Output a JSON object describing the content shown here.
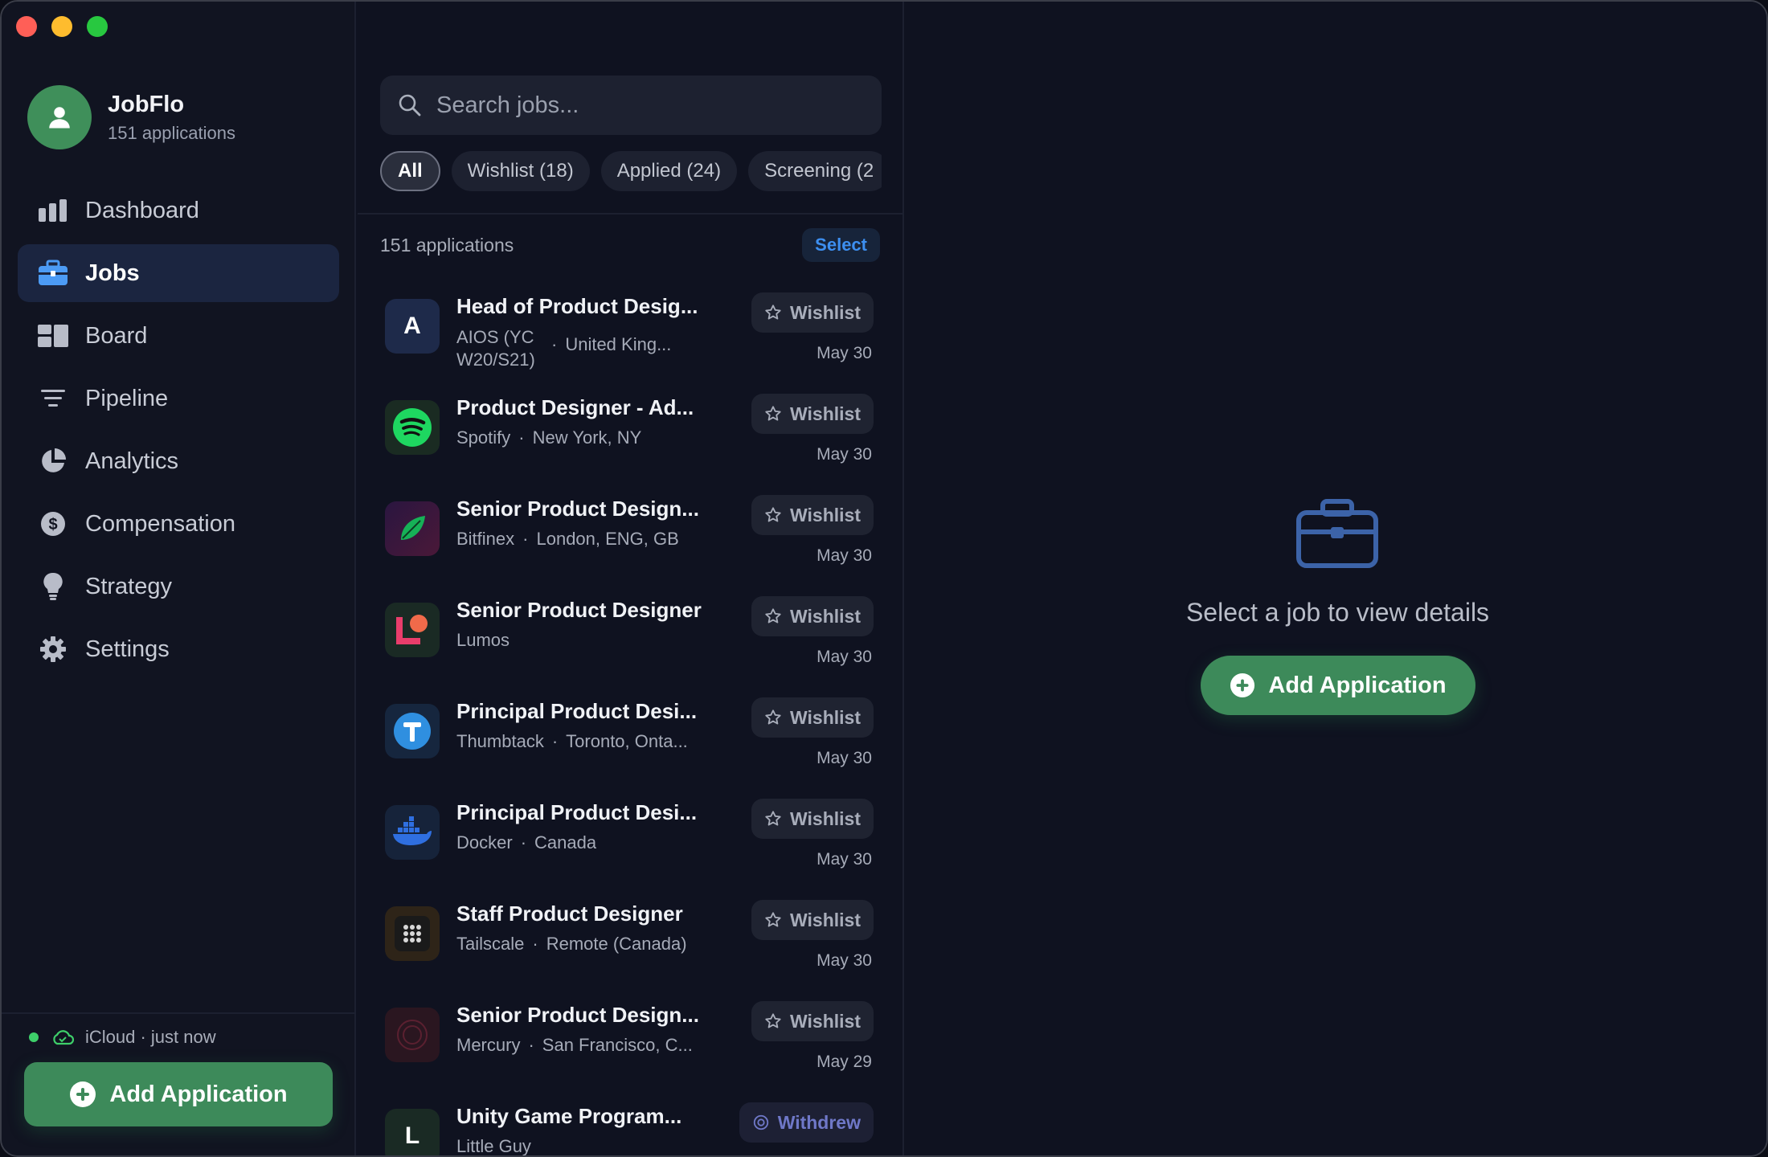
{
  "app": {
    "name": "JobFlo",
    "subtitle": "151 applications"
  },
  "sidebar": {
    "items": [
      {
        "label": "Dashboard",
        "icon": "dashboard-icon"
      },
      {
        "label": "Jobs",
        "icon": "briefcase-icon",
        "active": true
      },
      {
        "label": "Board",
        "icon": "board-icon"
      },
      {
        "label": "Pipeline",
        "icon": "pipeline-icon"
      },
      {
        "label": "Analytics",
        "icon": "pie-chart-icon"
      },
      {
        "label": "Compensation",
        "icon": "dollar-icon"
      },
      {
        "label": "Strategy",
        "icon": "lightbulb-icon"
      },
      {
        "label": "Settings",
        "icon": "gear-icon"
      }
    ],
    "sync_status": "iCloud · just now",
    "add_button": "Add Application"
  },
  "list": {
    "search_placeholder": "Search jobs...",
    "filters": [
      "All",
      "Wishlist (18)",
      "Applied (24)",
      "Screening (2"
    ],
    "count": "151 applications",
    "select_label": "Select",
    "jobs": [
      {
        "title": "Head of Product Desig...",
        "company": "AIOS (YC W20/S21)",
        "location": "United King...",
        "status": "Wishlist",
        "date": "May 30"
      },
      {
        "title": "Product Designer - Ad...",
        "company": "Spotify",
        "location": "New York, NY",
        "status": "Wishlist",
        "date": "May 30"
      },
      {
        "title": "Senior Product Design...",
        "company": "Bitfinex",
        "location": "London, ENG, GB",
        "status": "Wishlist",
        "date": "May 30"
      },
      {
        "title": "Senior Product Designer",
        "company": "Lumos",
        "location": "",
        "status": "Wishlist",
        "date": "May 30"
      },
      {
        "title": "Principal Product Desi...",
        "company": "Thumbtack",
        "location": "Toronto, Onta...",
        "status": "Wishlist",
        "date": "May 30"
      },
      {
        "title": "Principal Product Desi...",
        "company": "Docker",
        "location": "Canada",
        "status": "Wishlist",
        "date": "May 30"
      },
      {
        "title": "Staff Product Designer",
        "company": "Tailscale",
        "location": "Remote (Canada)",
        "status": "Wishlist",
        "date": "May 30"
      },
      {
        "title": "Senior Product Design...",
        "company": "Mercury",
        "location": "San Francisco, C...",
        "status": "Wishlist",
        "date": "May 29"
      },
      {
        "title": "Unity Game Program...",
        "company": "Little Guy",
        "location": "",
        "status": "Withdrew",
        "date": ""
      }
    ]
  },
  "detail": {
    "empty_text": "Select a job to view details",
    "add_button": "Add Application"
  },
  "colors": {
    "accent_green": "#3d8a5a",
    "accent_blue": "#3d8ff0",
    "active_nav": "#1b2540"
  }
}
